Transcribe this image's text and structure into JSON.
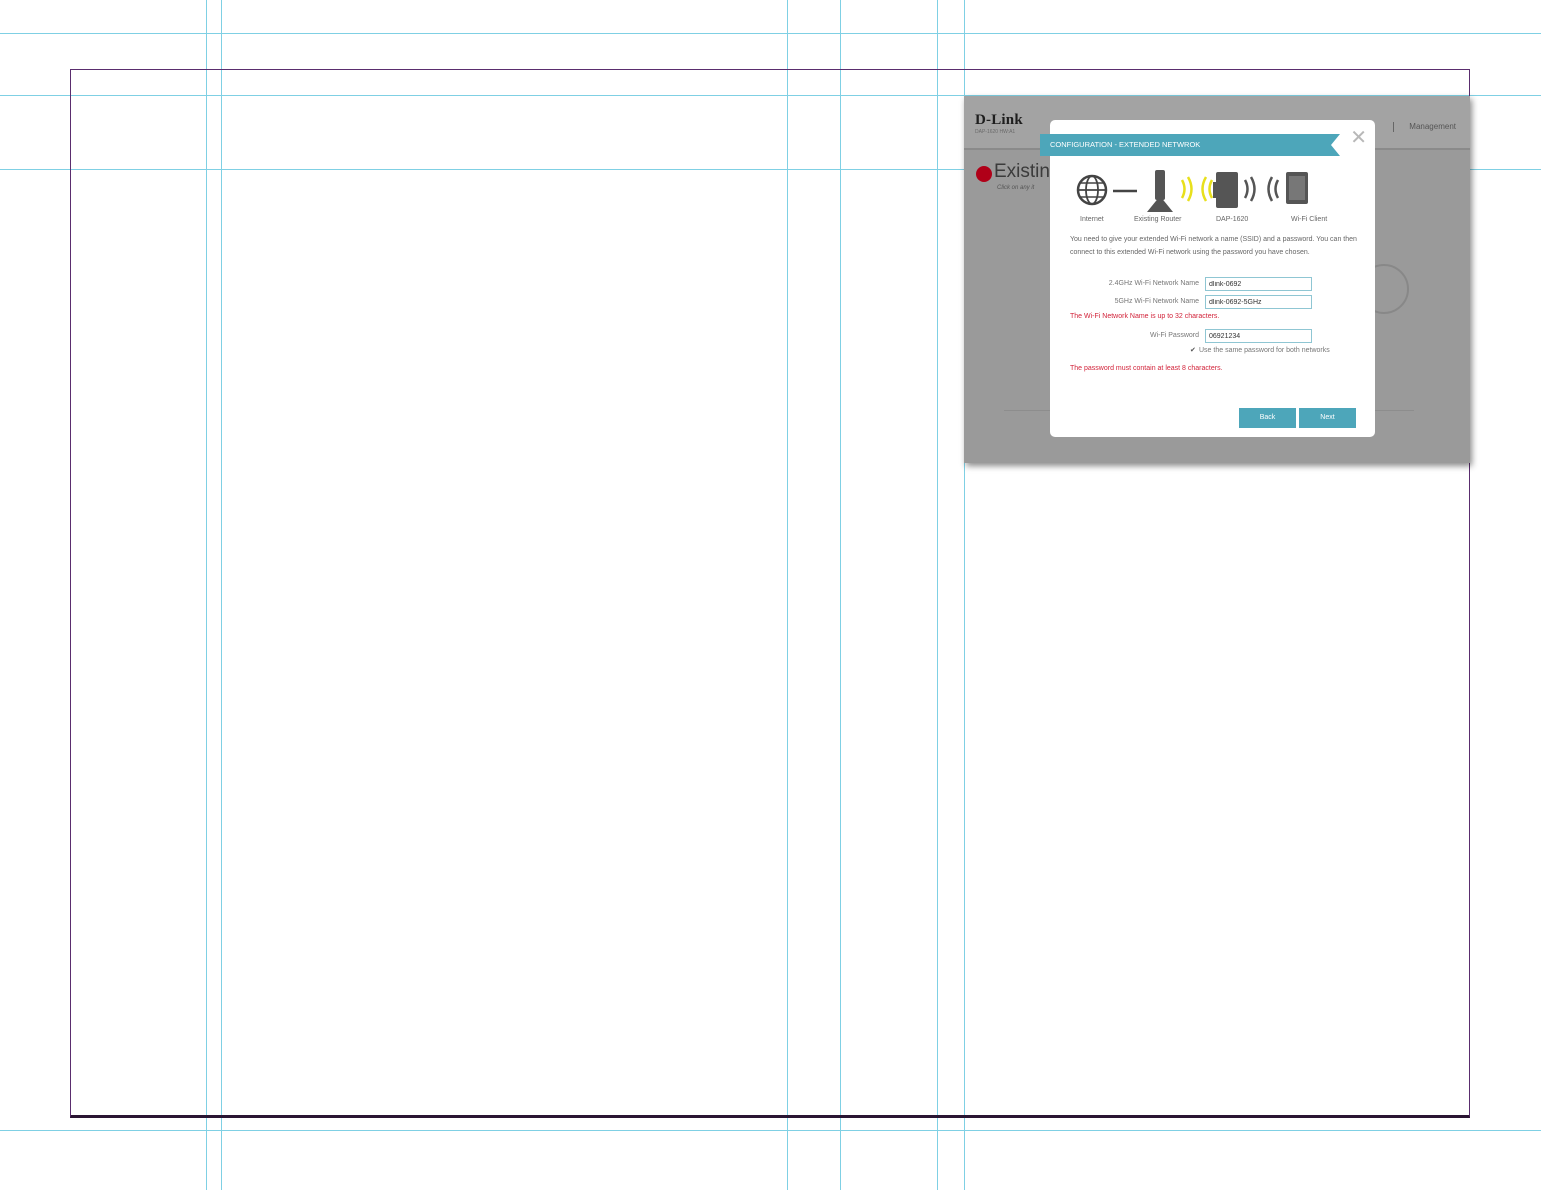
{
  "app": {
    "logo": "D-Link",
    "logo_sub": "DAP-1620   HW:A1",
    "nav_item": "Management"
  },
  "background": {
    "title": "Existin",
    "subtitle": "Click on any it"
  },
  "modal": {
    "title": "CONFIGURATION - EXTENDED NETWROK",
    "close_glyph": "✕",
    "diagram_labels": [
      "Internet",
      "Existing Router",
      "DAP-1620",
      "Wi-Fi Client"
    ],
    "description": "You need to give your extended Wi-Fi network a name (SSID) and a password. You can then connect to this extended Wi-Fi network using the password you have chosen.",
    "fields": {
      "ssid_24": {
        "label": "2.4GHz Wi-Fi Network Name",
        "value": "dlink-0692"
      },
      "ssid_5": {
        "label": "5GHz Wi-Fi Network Name",
        "value": "dlink-0692-5GHz"
      },
      "password": {
        "label": "Wi-Fi Password",
        "value": "06921234"
      }
    },
    "ssid_error": "The Wi-Fi Network Name is up to 32 characters.",
    "same_password": {
      "checked": true,
      "check_glyph": "✔",
      "label": "Use the same password for both networks"
    },
    "password_error": "The password must contain at least 8 characters.",
    "buttons": {
      "back": "Back",
      "next": "Next"
    }
  },
  "colors": {
    "accent": "#4da6ba",
    "error": "#d2233a",
    "overlay": "#9a9a9a",
    "wifi_yellow": "#e8e01c"
  },
  "icons": [
    "globe-icon",
    "router-icon",
    "wifi-signal-icon",
    "extender-icon",
    "tablet-icon",
    "close-icon",
    "checkmark-icon"
  ]
}
